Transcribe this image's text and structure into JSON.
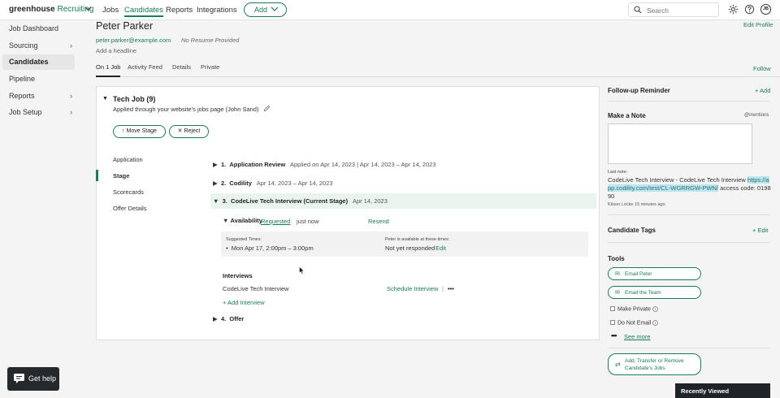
{
  "topbar": {
    "logo_main": "greenhouse",
    "logo_sub": "Recruiting",
    "nav": [
      "Jobs",
      "Candidates",
      "Reports",
      "Integrations"
    ],
    "add_label": "Add",
    "search_placeholder": "Search",
    "avatar_initials": "JB"
  },
  "sidebar": {
    "items": [
      {
        "label": "Job Dashboard"
      },
      {
        "label": "Sourcing"
      },
      {
        "label": "Candidates"
      },
      {
        "label": "Pipeline"
      },
      {
        "label": "Reports"
      },
      {
        "label": "Job Setup"
      }
    ]
  },
  "candidate": {
    "name": "Peter Parker",
    "email": "peter.parker@example.com",
    "resume": "No Resume Provided",
    "headline": "Add a headline",
    "edit_profile": "Edit Profile",
    "follow": "Follow"
  },
  "tabs": [
    "On 1 Job",
    "Activity Feed",
    "Details",
    "Private"
  ],
  "job": {
    "title": "Tech Job (9)",
    "applied": "Applied through your website's jobs page (John Sand)",
    "move_stage": "Move Stage",
    "reject": "Reject",
    "inner_nav": [
      "Application",
      "Stage",
      "Scorecards",
      "Offer Details"
    ],
    "stages": [
      {
        "num": "1.",
        "name": "Application Review",
        "dates": "Applied on Apr 14, 2023 | Apr 14, 2023 – Apr 14, 2023"
      },
      {
        "num": "2.",
        "name": "Codility",
        "dates": "Apr 14, 2023 – Apr 14, 2023"
      },
      {
        "num": "3.",
        "name": "CodeLive Tech Interview (Current Stage)",
        "dates": "Apr 14, 2023"
      },
      {
        "num": "4.",
        "name": "Offer",
        "dates": ""
      }
    ],
    "availability": {
      "label": "Availability",
      "status": "Requested",
      "time": "just now",
      "resend": "Resend",
      "suggested_label": "Suggested Times:",
      "suggested_time": "Mon Apr 17, 2:00pm – 3:00pm",
      "available_label": "Peter is available at these times:",
      "available_status": "Not yet responded",
      "edit": "Edit"
    },
    "interviews": {
      "label": "Interviews",
      "name": "CodeLive Tech Interview",
      "schedule": "Schedule Interview",
      "divider": "|",
      "more": "•••",
      "add": "+ Add Interview"
    }
  },
  "right": {
    "followup": "Follow-up Reminder",
    "followup_add": "+ Add",
    "make_note": "Make a Note",
    "mentions": "@mentions",
    "last_note_label": "Last note:",
    "last_note_text": "CodeLive Tech Interview - CodeLive Tech Interview ",
    "last_note_link": "https://app.codility.com/test/CL-WGRRGW-PWN/",
    "last_note_tail": " access code: 019890",
    "last_note_author": "Kitson Locke 15 minutes ago",
    "tags": "Candidate Tags",
    "tags_edit": "+ Edit",
    "tools": "Tools",
    "email_candidate": "Email Peter",
    "email_team": "Email the Team",
    "make_private": "Make Private",
    "do_not_email": "Do Not Email",
    "info": "i",
    "see_more": "See more",
    "transfer_line1": "Add, Transfer or Remove",
    "transfer_line2": "Candidate's Jobs"
  },
  "footer": {
    "get_help": "Get help",
    "recently_viewed": "Recently Viewed"
  }
}
